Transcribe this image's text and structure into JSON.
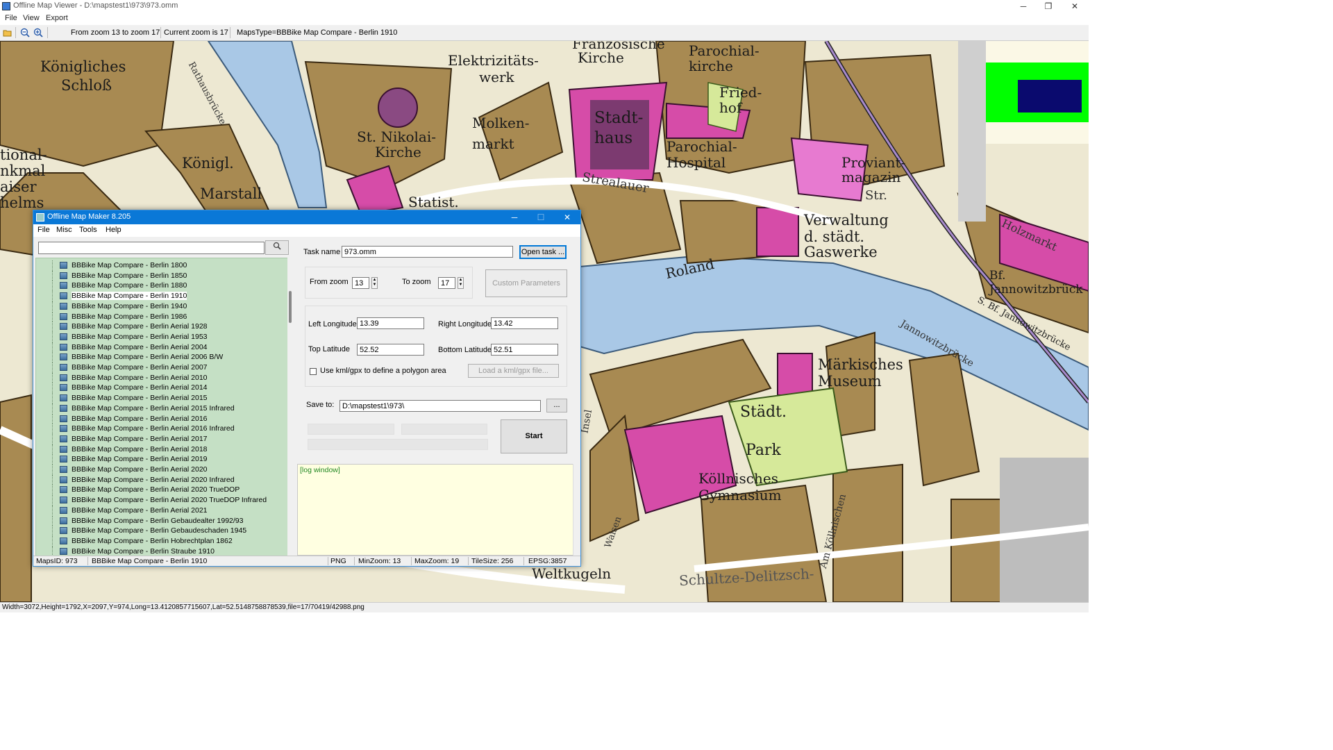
{
  "window": {
    "title": "Offline Map Viewer - D:\\mapstest1\\973\\973.omm",
    "menu": [
      "File",
      "View",
      "Export"
    ],
    "controls": {
      "minimize": "─",
      "restore": "❐",
      "close": "✕"
    }
  },
  "toolbar": {
    "zoom_range": "From zoom 13 to zoom 17",
    "current_zoom": "Current zoom is 17",
    "maps_type": "MapsType=BBBike Map Compare - Berlin 1910",
    "icons": [
      "open-folder-icon",
      "zoom-out-icon",
      "zoom-in-icon"
    ]
  },
  "map_labels": [
    "Königliches",
    "Schloß",
    "Königl.",
    "Marstall",
    "tional-",
    "nkmal",
    "aiser",
    "helms",
    "Elektrizitäts-",
    "werk",
    "Franzosische",
    "Kirche",
    "Parochial-",
    "kirche",
    "Fried-",
    "hof",
    "Stadt-",
    "haus",
    "Parochial-",
    "Hospital",
    "St. Nikolai-",
    "Kirche",
    "Molken-",
    "markt",
    "Proviant-",
    "magazin",
    "Verwaltung",
    "d. städt.",
    "Gaswerke",
    "Statist.",
    "Roland",
    "Bf.",
    "Jannowitzbrück",
    "Märkisches",
    "Museum",
    "Städt.",
    "Park",
    "Köllnisches",
    "Gymnasium",
    "Weltkugeln",
    "Schultze-Delitzsch-",
    "Am Köllnischen",
    "Str.",
    "Strealauer",
    "Rathausbrücke",
    "Jannowitzbrücke",
    "S. Bf. Jannowitzbrücke",
    "Holzmarkt",
    "Waisen",
    "Insel"
  ],
  "status_bar": "Width=3072,Height=1792,X=2097,Y=974,Long=13.4120857715607,Lat=52.5148758878539,file=17/70419/42988.png",
  "dialog": {
    "title": "Offline Map Maker 8.205",
    "menu": [
      "File",
      "Misc",
      "Tools",
      "Help"
    ],
    "search": {
      "value": "",
      "icon": "search-icon"
    },
    "tree_items": [
      "BBBike Map Compare - Berlin 1800",
      "BBBike Map Compare - Berlin 1850",
      "BBBike Map Compare - Berlin 1880",
      "BBBike Map Compare - Berlin 1910",
      "BBBike Map Compare - Berlin 1940",
      "BBBike Map Compare - Berlin 1986",
      "BBBike Map Compare - Berlin Aerial 1928",
      "BBBike Map Compare - Berlin Aerial 1953",
      "BBBike Map Compare - Berlin Aerial 2004",
      "BBBike Map Compare - Berlin Aerial 2006 B/W",
      "BBBike Map Compare - Berlin Aerial 2007",
      "BBBike Map Compare - Berlin Aerial 2010",
      "BBBike Map Compare - Berlin Aerial 2014",
      "BBBike Map Compare - Berlin Aerial 2015",
      "BBBike Map Compare - Berlin Aerial 2015 Infrared",
      "BBBike Map Compare - Berlin Aerial 2016",
      "BBBike Map Compare - Berlin Aerial 2016 Infrared",
      "BBBike Map Compare - Berlin Aerial 2017",
      "BBBike Map Compare - Berlin Aerial 2018",
      "BBBike Map Compare - Berlin Aerial 2019",
      "BBBike Map Compare - Berlin Aerial 2020",
      "BBBike Map Compare - Berlin Aerial 2020 Infrared",
      "BBBike Map Compare - Berlin Aerial 2020 TrueDOP",
      "BBBike Map Compare - Berlin Aerial 2020 TrueDOP Infrared",
      "BBBike Map Compare - Berlin Aerial 2021",
      "BBBike Map Compare - Berlin Gebaudealter 1992/93",
      "BBBike Map Compare - Berlin Gebaudeschaden 1945",
      "BBBike Map Compare - Berlin Hobrechtplan 1862",
      "BBBike Map Compare - Berlin Straube 1910"
    ],
    "selected_tree_item": "BBBike Map Compare - Berlin 1910",
    "task_name_label": "Task name",
    "task_name_value": "973.omm",
    "open_task_button": "Open task ...",
    "from_zoom_label": "From zoom",
    "from_zoom_value": "13",
    "to_zoom_label": "To zoom",
    "to_zoom_value": "17",
    "custom_parameters_button": "Custom Parameters",
    "left_longitude_label": "Left Longitude",
    "left_longitude_value": "13.39",
    "right_longitude_label": "Right Longitude",
    "right_longitude_value": "13.42",
    "top_latitude_label": "Top Latitude",
    "top_latitude_value": "52.52",
    "bottom_latitude_label": "Bottom Latitude",
    "bottom_latitude_value": "52.51",
    "use_kml_label": "Use kml/gpx to define a polygon area",
    "use_kml_checked": false,
    "load_kml_button": "Load a kml/gpx file...",
    "save_to_label": "Save to:",
    "save_to_value": "D:\\mapstest1\\973\\",
    "browse_button": "...",
    "start_button": "Start",
    "log_text": "[log window]",
    "status": {
      "maps_id": "MapsID: 973",
      "maps_name": "BBBike Map Compare - Berlin 1910",
      "format": "PNG",
      "min_zoom": "MinZoom: 13",
      "max_zoom": "MaxZoom: 19",
      "tile_size": "TileSize: 256",
      "epsg": "EPSG:3857"
    }
  },
  "colors": {
    "title_blue": "#0a78d7",
    "tree_green": "#c5e0c5",
    "log_yellow": "#ffffe1",
    "map_brown": "#a88a52",
    "map_magenta": "#d64ca8",
    "map_water": "#a9c8e6",
    "overview_green": "#00ff00",
    "overview_navy": "#0a0a6e"
  }
}
